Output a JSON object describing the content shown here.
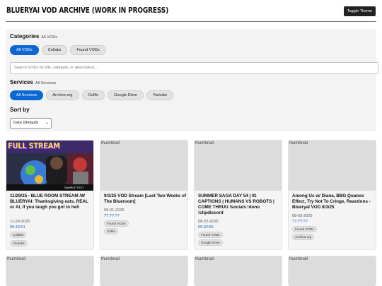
{
  "header": {
    "title": "BLUERYAI VOD ARCHIVE (WORK IN PROGRESS)",
    "toggle_theme_label": "Toggle Theme"
  },
  "filters": {
    "categories": {
      "label": "Categories",
      "current": "All VODs",
      "options": [
        "All VODs",
        "Collabs",
        "Found VODs"
      ],
      "selected": "All VODs"
    },
    "search": {
      "placeholder": "Search VODs by title, category, or description..."
    },
    "services": {
      "label": "Services",
      "current": "All Services",
      "options": [
        "All Services",
        "Archive.org",
        "Gofile",
        "Google Drive",
        "Youtube"
      ],
      "selected": "All Services"
    },
    "sort": {
      "label": "Sort by",
      "selected": "Date (Default)"
    }
  },
  "thumbnail_alt": "thumbnail",
  "thumbnail_overlay": {
    "banner": "FULL STREAM",
    "subtitle": "SAMPLE TEXT"
  },
  "cards": [
    {
      "title": "11/29/25 - BLUE ROOM STREAM /W BLUERYAI: Thanksgiving eats, REAL or AI, If you laugh you got to hell",
      "date": "11-29-2025",
      "duration": "05:43:51",
      "tags": [
        "Collabs",
        "Youtube"
      ],
      "has_image": true
    },
    {
      "title": "9/1/25 VOD Stream [Last Two Weeks of The Blueroom]",
      "date": "09-01-2025",
      "duration": "??:??:??",
      "tags": [
        "Found VODs",
        "Gofile"
      ],
      "has_image": false
    },
    {
      "title": "SUMMER SAGA DAY 54 | IG CAPTIONS | HUMANS VS ROBOTS | COME THRUU !socials !dono !clipdiscord",
      "date": "08-22-2025",
      "duration": "05:32:56",
      "tags": [
        "Found VODs",
        "Google Drive"
      ],
      "has_image": false
    },
    {
      "title": "Among Us w/ Diana, BBG Quanos Effect, Try Not To Cringe, Reactions - Blueryal VOD 8/3/25",
      "date": "08-03-2025",
      "duration": "??:??:??",
      "tags": [
        "Found VODs",
        "Archive.org"
      ],
      "has_image": false
    }
  ],
  "colors": {
    "accent": "#0a67d3",
    "duration_text": "#1a5fc4",
    "panel_bg": "#f3f3f3"
  }
}
